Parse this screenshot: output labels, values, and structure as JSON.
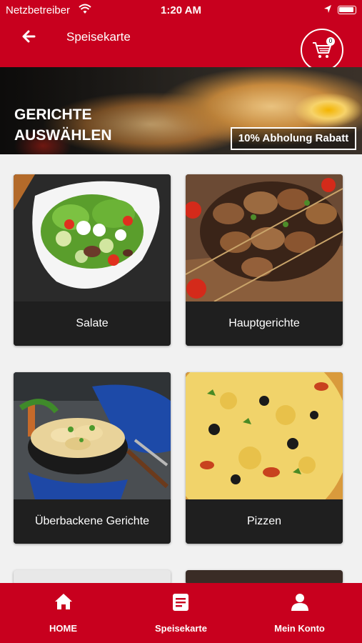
{
  "status_bar": {
    "carrier": "Netzbetreiber",
    "time": "1:20 AM"
  },
  "header": {
    "title": "Speisekarte",
    "cart_count": "0"
  },
  "banner": {
    "title_line1": "GERICHTE",
    "title_line2": "AUSWÄHLEN",
    "promo": "10% Abholung Rabatt"
  },
  "categories": [
    {
      "label": "Salate"
    },
    {
      "label": "Hauptgerichte"
    },
    {
      "label": "Überbackene Gerichte"
    },
    {
      "label": "Pizzen"
    }
  ],
  "bottom_nav": {
    "home": "HOME",
    "menu": "Speisekarte",
    "account": "Mein Konto"
  },
  "colors": {
    "brand_red": "#c8001e",
    "card_label_bg": "#1f1f1f"
  }
}
